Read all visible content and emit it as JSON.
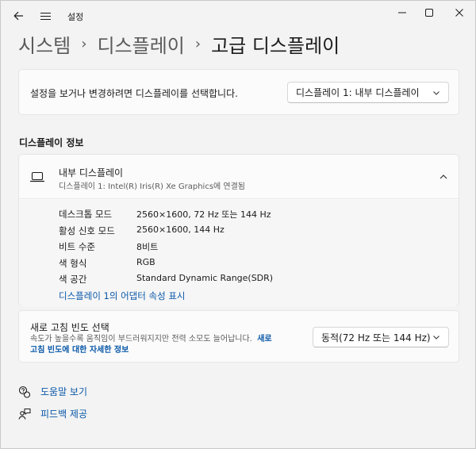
{
  "window": {
    "title": "설정"
  },
  "breadcrumb": {
    "items": [
      "시스템",
      "디스플레이",
      "고급 디스플레이"
    ],
    "separator": "›"
  },
  "display_select": {
    "label": "설정을 보거나 변경하려면 디스플레이를 선택합니다.",
    "selected": "디스플레이 1: 내부 디스플레이"
  },
  "display_info": {
    "section_title": "디스플레이 정보",
    "name": "내부 디스플레이",
    "subtitle": "디스플레이 1: Intel(R) Iris(R) Xe Graphics에 연결됨",
    "rows": [
      {
        "key": "데스크톱 모드",
        "value": "2560×1600, 72 Hz 또는 144 Hz"
      },
      {
        "key": "활성 신호 모드",
        "value": "2560×1600, 144 Hz"
      },
      {
        "key": "비트 수준",
        "value": "8비트"
      },
      {
        "key": "색 형식",
        "value": "RGB"
      },
      {
        "key": "색 공간",
        "value": "Standard Dynamic Range(SDR)"
      }
    ],
    "adapter_link": "디스플레이 1의 어댑터 속성 표시"
  },
  "refresh_rate": {
    "title": "새로 고침 빈도 선택",
    "description": "속도가 높을수록 움직임이 부드러워지지만 전력 소모도 늘어납니다.",
    "link_part1": "새로",
    "link_part2": "고침 빈도에 대한 자세한 정보",
    "selected": "동적(72 Hz 또는 144 Hz)"
  },
  "footer": {
    "help": "도움말 보기",
    "feedback": "피드백 제공"
  },
  "colors": {
    "accent": "#0a58a8",
    "background": "#f3f3f3",
    "card": "#fbfbfb"
  }
}
